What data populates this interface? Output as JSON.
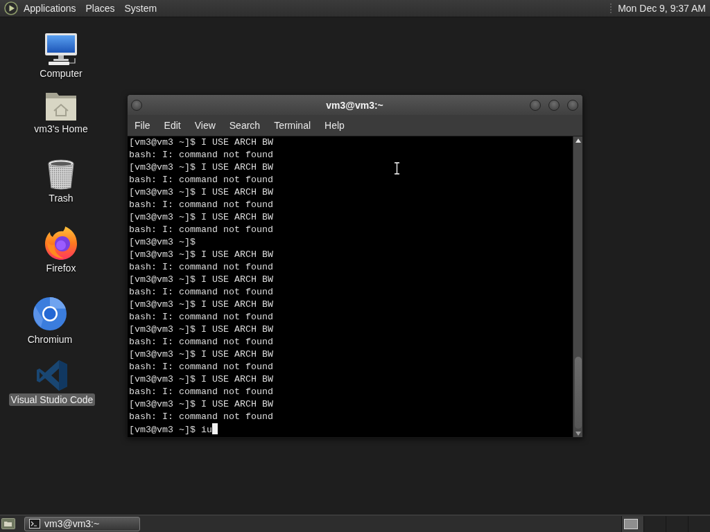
{
  "top_panel": {
    "menus": [
      "Applications",
      "Places",
      "System"
    ],
    "clock": "Mon Dec 9, 9:37 AM"
  },
  "desktop_icons": [
    {
      "kind": "computer",
      "label": "Computer",
      "selected": false
    },
    {
      "kind": "home",
      "label": "vm3's Home",
      "selected": false
    },
    {
      "kind": "trash",
      "label": "Trash",
      "selected": false
    },
    {
      "kind": "firefox",
      "label": "Firefox",
      "selected": false
    },
    {
      "kind": "chromium",
      "label": "Chromium",
      "selected": false
    },
    {
      "kind": "vscode",
      "label": "Visual Studio Code",
      "selected": true
    }
  ],
  "terminal_window": {
    "title": "vm3@vm3:~",
    "menu": [
      "File",
      "Edit",
      "View",
      "Search",
      "Terminal",
      "Help"
    ],
    "lines": [
      "[vm3@vm3 ~]$ I USE ARCH BW",
      "bash: I: command not found",
      "[vm3@vm3 ~]$ I USE ARCH BW",
      "bash: I: command not found",
      "[vm3@vm3 ~]$ I USE ARCH BW",
      "bash: I: command not found",
      "[vm3@vm3 ~]$ I USE ARCH BW",
      "bash: I: command not found",
      "[vm3@vm3 ~]$",
      "[vm3@vm3 ~]$ I USE ARCH BW",
      "bash: I: command not found",
      "[vm3@vm3 ~]$ I USE ARCH BW",
      "bash: I: command not found",
      "[vm3@vm3 ~]$ I USE ARCH BW",
      "bash: I: command not found",
      "[vm3@vm3 ~]$ I USE ARCH BW",
      "bash: I: command not found",
      "[vm3@vm3 ~]$ I USE ARCH BW",
      "bash: I: command not found",
      "[vm3@vm3 ~]$ I USE ARCH BW",
      "bash: I: command not found",
      "[vm3@vm3 ~]$ I USE ARCH BW",
      "bash: I: command not found",
      "[vm3@vm3 ~]$ iu"
    ]
  },
  "taskbar": {
    "tasks": [
      {
        "label": "vm3@vm3:~",
        "selected": true
      }
    ],
    "workspaces": [
      {
        "selected": true
      },
      {
        "selected": false
      },
      {
        "selected": false
      },
      {
        "selected": false
      }
    ]
  }
}
